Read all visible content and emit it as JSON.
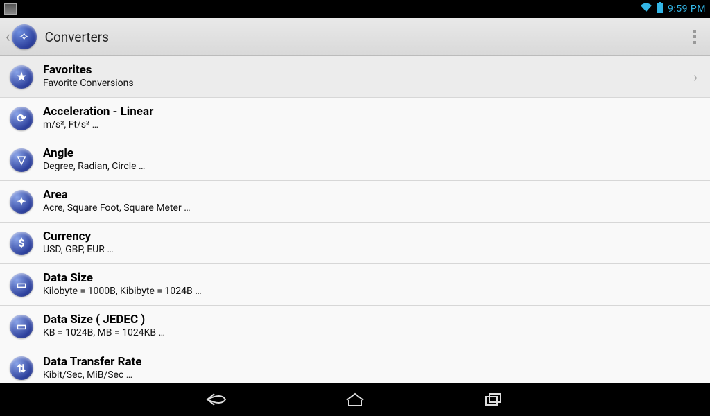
{
  "status": {
    "time": "9:59 PM"
  },
  "actionbar": {
    "title": "Converters"
  },
  "rows": [
    {
      "icon": "★",
      "title": "Favorites",
      "sub": "Favorite Conversions",
      "chevron": true
    },
    {
      "icon": "⟳",
      "title": "Acceleration - Linear",
      "sub": "m/s², Ft/s² …",
      "chevron": false
    },
    {
      "icon": "▽",
      "title": "Angle",
      "sub": "Degree, Radian, Circle …",
      "chevron": false
    },
    {
      "icon": "✦",
      "title": "Area",
      "sub": "Acre, Square Foot, Square Meter …",
      "chevron": false
    },
    {
      "icon": "$",
      "title": "Currency",
      "sub": "USD, GBP, EUR …",
      "chevron": false
    },
    {
      "icon": "▭",
      "title": "Data Size",
      "sub": "Kilobyte = 1000B, Kibibyte = 1024B …",
      "chevron": false
    },
    {
      "icon": "▭",
      "title": "Data Size ( JEDEC )",
      "sub": "KB = 1024B, MB = 1024KB …",
      "chevron": false
    },
    {
      "icon": "⇅",
      "title": "Data Transfer Rate",
      "sub": "Kibit/Sec, MiB/Sec …",
      "chevron": false
    }
  ]
}
